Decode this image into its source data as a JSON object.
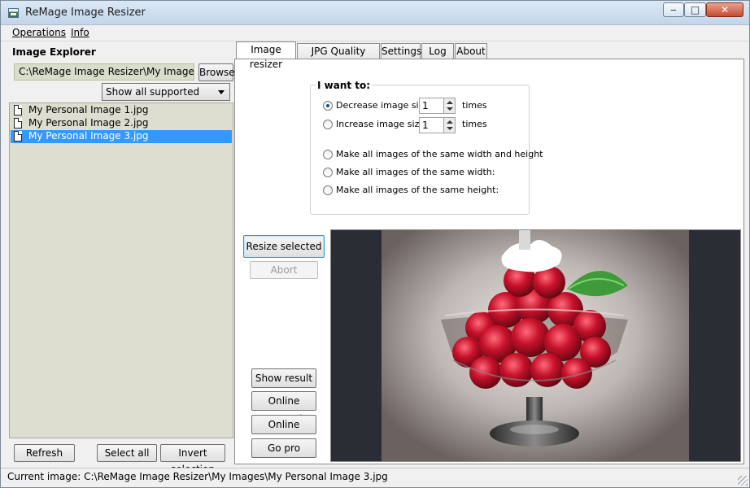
{
  "window": {
    "title": "ReMage Image Resizer",
    "minimize": "‒",
    "maximize": "□",
    "close": "✕"
  },
  "menu": {
    "operations": "Operations",
    "info": "Info"
  },
  "explorer": {
    "title": "Image Explorer",
    "path": "C:\\ReMage Image Resizer\\My Images\\",
    "browse": "Browse",
    "filter": "Show all supported pictures",
    "files": [
      "My Personal Image 1.jpg",
      "My Personal Image 2.jpg",
      "My Personal Image 3.jpg"
    ],
    "selected_index": 2,
    "refresh": "Refresh",
    "select_all": "Select all",
    "invert_selection": "Invert selection"
  },
  "tabs": [
    "Image resizer",
    "JPG Quality advisor",
    "Settings",
    "Log",
    "About"
  ],
  "active_tab": "Image resizer",
  "resizer": {
    "group_title": "I want to:",
    "decrease_label": "Decrease image size",
    "decrease_value": "1",
    "increase_label": "Increase image size",
    "increase_value": "1",
    "times": "times",
    "same_wh": "Make all images of the same width and height",
    "same_w": "Make all images of the same width:",
    "same_h": "Make all images of the same height:"
  },
  "actions": {
    "resize_selected": "Resize selected",
    "abort": "Abort",
    "show_result": "Show result",
    "online_manual": "Online manual",
    "online_support": "Online support",
    "go_pro": "Go pro"
  },
  "status": {
    "current_image": "Current image: C:\\ReMage Image Resizer\\My Images\\My Personal Image 3.jpg"
  },
  "colors": {
    "selection": "#3399ff",
    "explorer_bg": "#deded0",
    "path_bg": "#d8dec9"
  }
}
